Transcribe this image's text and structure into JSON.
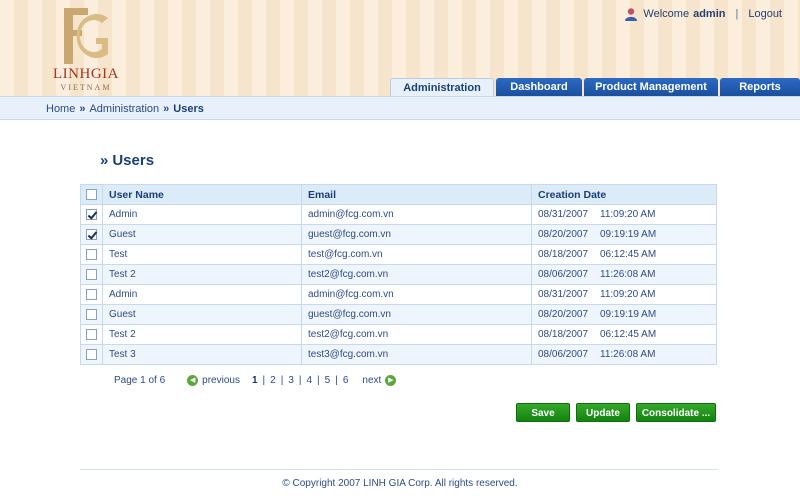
{
  "brand": {
    "name": "LINHGIA",
    "sub": "VIETNAM"
  },
  "user": {
    "welcome": "Welcome",
    "name": "admin",
    "logout": "Logout"
  },
  "tabs": [
    {
      "label": "Administration"
    },
    {
      "label": "Dashboard"
    },
    {
      "label": "Product Management"
    },
    {
      "label": "Reports"
    }
  ],
  "breadcrumb": {
    "home": "Home",
    "section": "Administration",
    "current": "Users"
  },
  "page": {
    "title": "Users"
  },
  "table": {
    "headers": {
      "name": "User Name",
      "email": "Email",
      "created": "Creation Date"
    },
    "rows": [
      {
        "checked": true,
        "name": "Admin",
        "email": "admin@fcg.com.vn",
        "date": "08/31/2007",
        "time": "11:09:20 AM"
      },
      {
        "checked": true,
        "name": "Guest",
        "email": "guest@fcg.com.vn",
        "date": "08/20/2007",
        "time": "09:19:19 AM"
      },
      {
        "checked": false,
        "name": "Test",
        "email": "test@fcg.com.vn",
        "date": "08/18/2007",
        "time": "06:12:45 AM"
      },
      {
        "checked": false,
        "name": "Test 2",
        "email": "test2@fcg.com.vn",
        "date": "08/06/2007",
        "time": "11:26:08 AM"
      },
      {
        "checked": false,
        "name": "Admin",
        "email": "admin@fcg.com.vn",
        "date": "08/31/2007",
        "time": "11:09:20 AM"
      },
      {
        "checked": false,
        "name": "Guest",
        "email": "guest@fcg.com.vn",
        "date": "08/20/2007",
        "time": "09:19:19 AM"
      },
      {
        "checked": false,
        "name": "Test 2",
        "email": "test2@fcg.com.vn",
        "date": "08/18/2007",
        "time": "06:12:45 AM"
      },
      {
        "checked": false,
        "name": "Test 3",
        "email": "test3@fcg.com.vn",
        "date": "08/06/2007",
        "time": "11:26:08 AM"
      }
    ]
  },
  "pager": {
    "info": "Page 1 of 6",
    "previous": "previous",
    "next": "next",
    "pages": [
      "1",
      "2",
      "3",
      "4",
      "5",
      "6"
    ],
    "current": "1"
  },
  "actions": {
    "save": "Save",
    "update": "Update",
    "consolidate": "Consolidate ..."
  },
  "footer": {
    "copyright": "© Copyright 2007 LINH GIA Corp. All rights reserved."
  },
  "colors": {
    "brand_red": "#a8341e",
    "tab_blue": "#1b4f9e",
    "button_green": "#13830f",
    "link_blue": "#2d4b85"
  }
}
